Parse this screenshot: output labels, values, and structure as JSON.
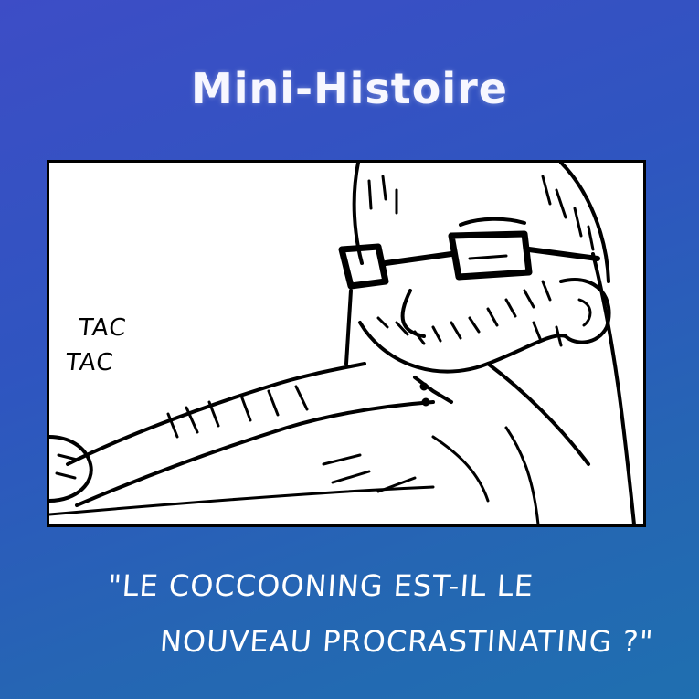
{
  "header": {
    "title": "Mini-Histoire"
  },
  "panel": {
    "sound_effect_1": "TAC",
    "sound_effect_2": "TAC"
  },
  "caption": {
    "line1": "\"LE COCCOONING EST-IL LE",
    "line2": "NOUVEAU PROCRASTINATING ?\""
  },
  "colors": {
    "background_top": "#3d4dc6",
    "background_bottom": "#1f6fb0",
    "panel_bg": "#ffffff",
    "ink": "#000000",
    "text": "#ffffff"
  }
}
